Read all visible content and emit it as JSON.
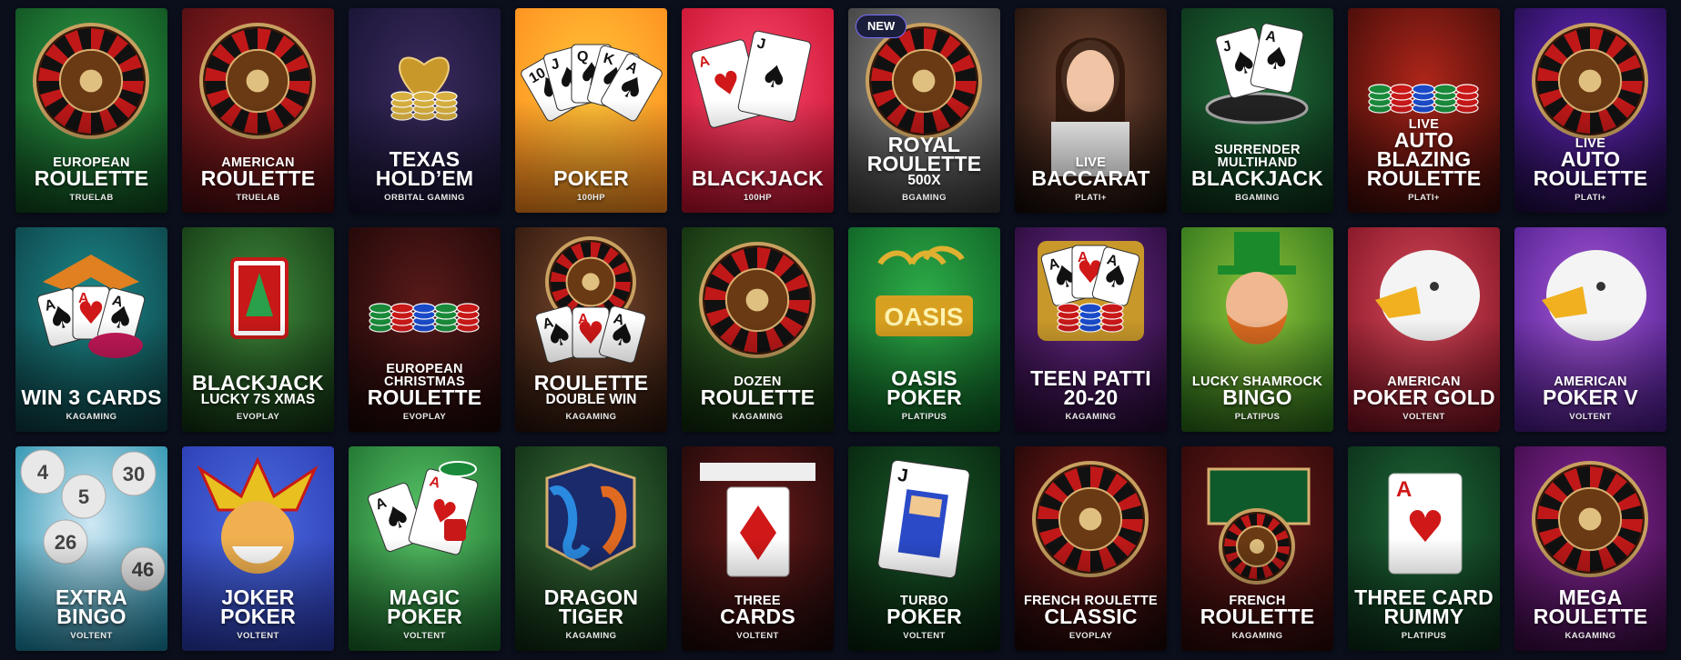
{
  "badge_new": "NEW",
  "games": [
    {
      "lines": [
        [
          "EUROPEAN",
          "small"
        ],
        [
          "ROULETTE",
          "big"
        ]
      ],
      "provider": "TRUELAB",
      "bg": [
        "#2f9e48",
        "#0e4a1e"
      ],
      "icon": "roulette-wheel-icon"
    },
    {
      "lines": [
        [
          "AMERICAN",
          "small"
        ],
        [
          "ROULETTE",
          "big"
        ]
      ],
      "provider": "TRUELAB",
      "bg": [
        "#9b2424",
        "#4a0c10"
      ],
      "icon": "roulette-wheel-icon"
    },
    {
      "lines": [
        [
          "TEXAS",
          "big"
        ],
        [
          "HOLD’EM",
          "big"
        ]
      ],
      "provider": "ORBITAL GAMING",
      "bg": [
        "#3a2a5e",
        "#151230"
      ],
      "icon": "heart-chips-icon"
    },
    {
      "lines": [
        [
          "POKER",
          "big"
        ]
      ],
      "provider": "100HP",
      "bg": [
        "#ffc53a",
        "#ff8a1c"
      ],
      "icon": "playing-cards-fan-icon"
    },
    {
      "lines": [
        [
          "BLACKJACK",
          "big"
        ]
      ],
      "provider": "100HP",
      "bg": [
        "#ff4a6e",
        "#c4102e"
      ],
      "icon": "ace-jack-cards-icon"
    },
    {
      "lines": [
        [
          "ROYAL",
          "big"
        ],
        [
          "ROULETTE",
          "big"
        ],
        [
          "500X",
          "mid"
        ]
      ],
      "provider": "BGAMING",
      "bg": [
        "#8a8a8a",
        "#3a3a3a"
      ],
      "icon": "roulette-wheel-icon"
    },
    {
      "lines": [
        [
          "LIVE",
          "small"
        ],
        [
          "BACCARAT",
          "big"
        ]
      ],
      "provider": "PLATI+",
      "bg": [
        "#7a4a34",
        "#160b08"
      ],
      "icon": "live-dealer-avatar"
    },
    {
      "lines": [
        [
          "SURRENDER",
          "small"
        ],
        [
          "MULTIHAND",
          "small"
        ],
        [
          "BLACKJACK",
          "big"
        ]
      ],
      "provider": "BGAMING",
      "bg": [
        "#1f6e3a",
        "#0c2e18"
      ],
      "icon": "gold-cards-chip-icon"
    },
    {
      "lines": [
        [
          "LIVE",
          "small"
        ],
        [
          "AUTO",
          "big"
        ],
        [
          "BLAZING",
          "big"
        ],
        [
          "ROULETTE",
          "big"
        ]
      ],
      "provider": "PLATI+",
      "bg": [
        "#b0261a",
        "#3a0a08"
      ],
      "icon": "chip-stacks-icon"
    },
    {
      "lines": [
        [
          "LIVE",
          "small"
        ],
        [
          "AUTO",
          "big"
        ],
        [
          "ROULETTE",
          "big"
        ]
      ],
      "provider": "PLATI+",
      "bg": [
        "#6a2ac4",
        "#1e0b44"
      ],
      "icon": "roulette-wheel-icon"
    },
    {
      "lines": [
        [
          "WIN 3 CARDS",
          "big"
        ]
      ],
      "provider": "KAGAMING",
      "bg": [
        "#1c8a8a",
        "#0d3e44"
      ],
      "icon": "dragon-cards-icon"
    },
    {
      "lines": [
        [
          "BLACKJACK",
          "big"
        ],
        [
          "LUCKY 7S XMAS",
          "mid"
        ]
      ],
      "provider": "EVOPLAY",
      "bg": [
        "#3f8a3a",
        "#123312"
      ],
      "icon": "lucky-seven-card-icon"
    },
    {
      "lines": [
        [
          "EUROPEAN",
          "small"
        ],
        [
          "CHRISTMAS",
          "small"
        ],
        [
          "ROULETTE",
          "big"
        ]
      ],
      "provider": "EVOPLAY",
      "bg": [
        "#5a1a1a",
        "#1a0606"
      ],
      "icon": "chip-stacks-icon"
    },
    {
      "lines": [
        [
          "ROULETTE",
          "big"
        ],
        [
          "DOUBLE WIN",
          "mid"
        ]
      ],
      "provider": "KAGAMING",
      "bg": [
        "#7a4a30",
        "#2a140a"
      ],
      "icon": "roulette-cards-icon"
    },
    {
      "lines": [
        [
          "DOZEN",
          "small"
        ],
        [
          "ROULETTE",
          "big"
        ]
      ],
      "provider": "KAGAMING",
      "bg": [
        "#3a6a2a",
        "#0f2a0c"
      ],
      "icon": "roulette-wheel-icon"
    },
    {
      "lines": [
        [
          "OASIS POKER",
          "big"
        ]
      ],
      "provider": "PLATIPUS",
      "bg": [
        "#2fb04a",
        "#0c5a22"
      ],
      "icon": "oasis-logo-icon"
    },
    {
      "lines": [
        [
          "TEEN PATTI",
          "big"
        ],
        [
          "20-20",
          "big"
        ]
      ],
      "provider": "KAGAMING",
      "bg": [
        "#6a2a8a",
        "#250a34"
      ],
      "icon": "cards-chips-icon"
    },
    {
      "lines": [
        [
          "LUCKY SHAMROCK",
          "small"
        ],
        [
          "BINGO",
          "big"
        ]
      ],
      "provider": "PLATIPUS",
      "bg": [
        "#8ec63a",
        "#2a6e1a"
      ],
      "icon": "leprechaun-icon"
    },
    {
      "lines": [
        [
          "AMERICAN",
          "small"
        ],
        [
          "POKER GOLD",
          "big"
        ]
      ],
      "provider": "VOLTENT",
      "bg": [
        "#d84a5a",
        "#7a1020"
      ],
      "icon": "eagle-icon"
    },
    {
      "lines": [
        [
          "AMERICAN",
          "small"
        ],
        [
          "POKER V",
          "big"
        ]
      ],
      "provider": "VOLTENT",
      "bg": [
        "#a85ad8",
        "#4a1a8a"
      ],
      "icon": "eagle-icon"
    },
    {
      "lines": [
        [
          "EXTRA BINGO",
          "big"
        ]
      ],
      "provider": "VOLTENT",
      "bg": [
        "#cfe8f4",
        "#1a8aa8"
      ],
      "icon": "bingo-balls-icon"
    },
    {
      "lines": [
        [
          "JOKER POKER",
          "big"
        ]
      ],
      "provider": "VOLTENT",
      "bg": [
        "#4a6ae0",
        "#2a3ab0"
      ],
      "icon": "joker-icon"
    },
    {
      "lines": [
        [
          "MAGIC",
          "big"
        ],
        [
          "POKER",
          "big"
        ]
      ],
      "provider": "VOLTENT",
      "bg": [
        "#5ac86a",
        "#1a6a2a"
      ],
      "icon": "cards-dice-icon"
    },
    {
      "lines": [
        [
          "DRAGON",
          "big"
        ],
        [
          "TIGER",
          "big"
        ]
      ],
      "provider": "KAGAMING",
      "bg": [
        "#3a6e3a",
        "#0e2a12"
      ],
      "icon": "dragon-tiger-icon"
    },
    {
      "lines": [
        [
          "THREE",
          "small"
        ],
        [
          "CARDS",
          "big"
        ]
      ],
      "provider": "VOLTENT",
      "bg": [
        "#6a1a1a",
        "#1a0808"
      ],
      "icon": "diamond-card-icon"
    },
    {
      "lines": [
        [
          "TURBO",
          "small"
        ],
        [
          "POKER",
          "big"
        ]
      ],
      "provider": "VOLTENT",
      "bg": [
        "#1a5a2a",
        "#06200c"
      ],
      "icon": "jack-card-icon"
    },
    {
      "lines": [
        [
          "FRENCH ROULETTE",
          "small"
        ],
        [
          "CLASSIC",
          "big"
        ]
      ],
      "provider": "EVOPLAY",
      "bg": [
        "#7a1a1a",
        "#1a0606"
      ],
      "icon": "roulette-wheel-icon"
    },
    {
      "lines": [
        [
          "FRENCH",
          "small"
        ],
        [
          "ROULETTE",
          "big"
        ]
      ],
      "provider": "KAGAMING",
      "bg": [
        "#6a1a1a",
        "#2a0808"
      ],
      "icon": "roulette-table-icon"
    },
    {
      "lines": [
        [
          "THREE CARD",
          "big"
        ],
        [
          "RUMMY",
          "big"
        ]
      ],
      "provider": "PLATIPUS",
      "bg": [
        "#1f6a3a",
        "#0a2a16"
      ],
      "icon": "ace-hearts-card-icon"
    },
    {
      "lines": [
        [
          "MEGA",
          "big"
        ],
        [
          "ROULETTE",
          "big"
        ]
      ],
      "provider": "KAGAMING",
      "bg": [
        "#8a2a9a",
        "#3a0a44"
      ],
      "icon": "roulette-wheel-icon"
    }
  ]
}
